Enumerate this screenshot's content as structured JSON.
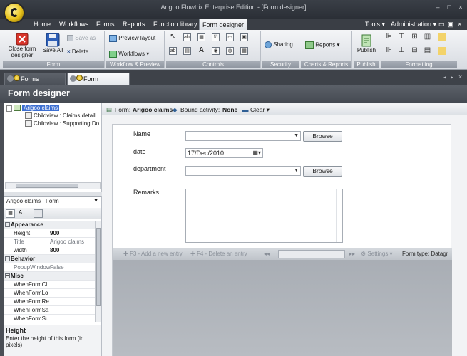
{
  "window": {
    "title": "Arigoo Flowtrix Enterprise Edition - [Form designer]",
    "minimize": "–",
    "maximize": "□",
    "close": "×"
  },
  "menu": {
    "items": [
      "Home",
      "Workflows",
      "Forms",
      "Reports",
      "Function library",
      "Form designer"
    ],
    "tools": "Tools",
    "administration": "Administration"
  },
  "ribbon": {
    "groups": {
      "form": "Form",
      "workflow_preview": "Workflow & Preview",
      "controls": "Controls",
      "security": "Security",
      "charts_reports": "Charts & Reports",
      "publish": "Publish",
      "formatting": "Formatting"
    },
    "close_form": "Close form designer",
    "save_all": "Save All",
    "save_as": "Save as",
    "delete": "Delete",
    "preview_layout": "Preview layout",
    "workflows": "Workflows",
    "sharing": "Sharing",
    "reports": "Reports",
    "publish": "Publish",
    "control_glyphs": [
      "↖",
      "ab|",
      "▦",
      "☑",
      "▭",
      "▣",
      "ab",
      "▤",
      "A",
      "◉",
      "◍",
      "▦"
    ]
  },
  "doc_tabs": [
    "Forms browser",
    "Form designer"
  ],
  "header": {
    "title": "Form designer"
  },
  "tree": {
    "root": "Arigoo claims",
    "children": [
      "Childview : Claims detail",
      "Childview : Supporting Do"
    ]
  },
  "object_selector": {
    "name": "Arigoo claims",
    "type": "Form"
  },
  "properties": {
    "appearance": "Appearance",
    "behavior": "Behavior",
    "misc": "Misc",
    "rows": [
      {
        "name": "Height",
        "value": "900",
        "bold": true
      },
      {
        "name": "Title",
        "value": "Arigoo claims",
        "bold": false
      },
      {
        "name": "width",
        "value": "800",
        "bold": true
      }
    ],
    "behavior_rows": [
      {
        "name": "PopupWindow",
        "value": "False"
      }
    ],
    "misc_rows": [
      "WhenFormCl",
      "WhenFormLo",
      "WhenFormRe",
      "WhenFormSa",
      "WhenFormSu"
    ]
  },
  "help": {
    "title": "Height",
    "text": "Enter the height of this form (in pixels)"
  },
  "formbar": {
    "form_label": "Form:",
    "form_name": "Arigoo claims",
    "bound_label": "Bound activity:",
    "bound_value": "None",
    "clear": "Clear"
  },
  "form_fields": {
    "name_label": "Name",
    "date_label": "date",
    "date_value": "17/Dec/2010",
    "department_label": "department",
    "remarks_label": "Remarks",
    "browse": "Browse"
  },
  "subgrid": {
    "add_entry": "F3 - Add a new entry",
    "delete_entry": "F4 - Delete an entry",
    "settings": "Settings",
    "form_type": "Form type: Datagr"
  }
}
